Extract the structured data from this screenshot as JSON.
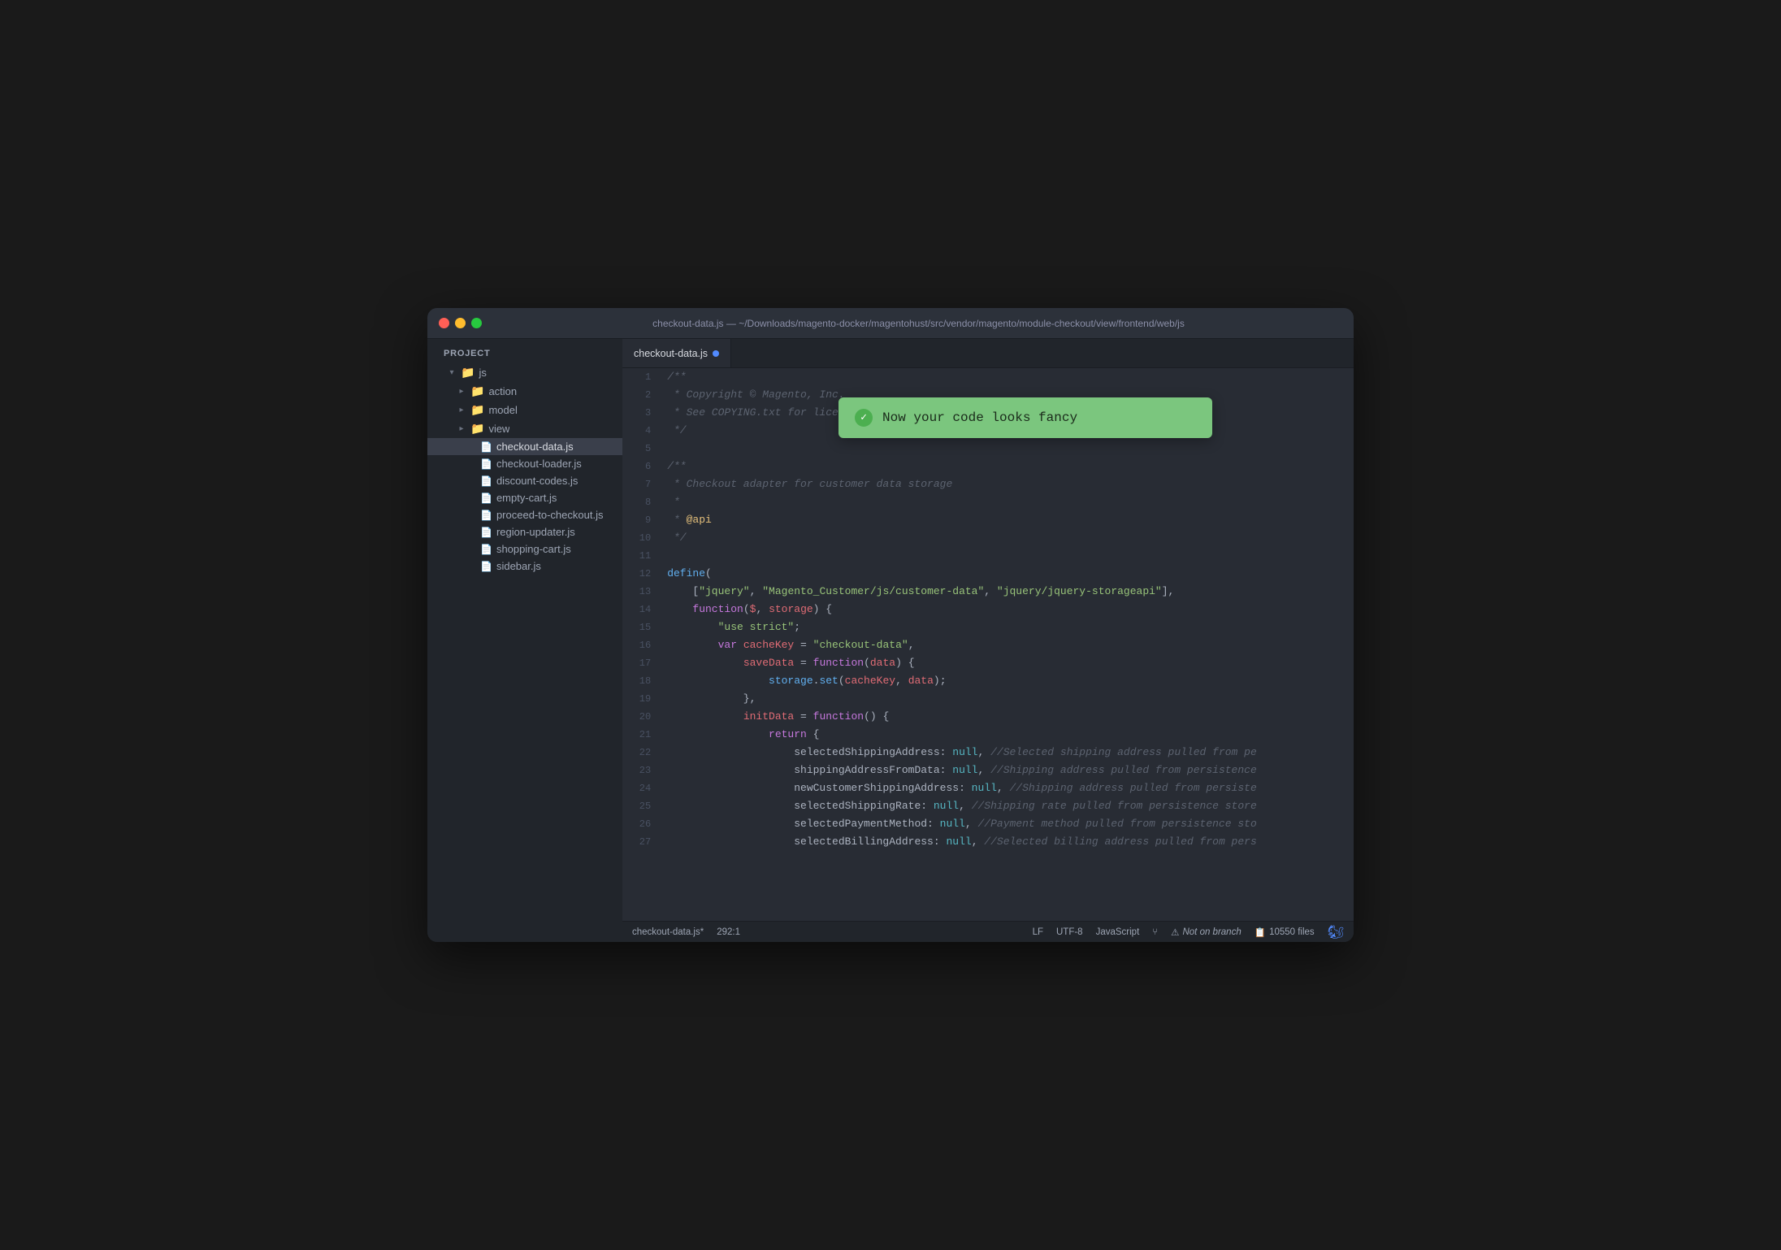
{
  "window": {
    "title": "checkout-data.js — ~/Downloads/magento-docker/magentohust/src/vendor/magento/module-checkout/view/frontend/web/js"
  },
  "titleBar": {
    "trafficLights": [
      "close",
      "minimize",
      "maximize"
    ]
  },
  "sidebar": {
    "title": "Project",
    "tree": [
      {
        "id": "js",
        "label": "js",
        "type": "folder",
        "level": 0,
        "expanded": true
      },
      {
        "id": "action",
        "label": "action",
        "type": "folder",
        "level": 1,
        "expanded": false
      },
      {
        "id": "model",
        "label": "model",
        "type": "folder",
        "level": 1,
        "expanded": false
      },
      {
        "id": "view",
        "label": "view",
        "type": "folder",
        "level": 1,
        "expanded": false
      },
      {
        "id": "checkout-data.js",
        "label": "checkout-data.js",
        "type": "file",
        "level": 2,
        "active": true
      },
      {
        "id": "checkout-loader.js",
        "label": "checkout-loader.js",
        "type": "file",
        "level": 2
      },
      {
        "id": "discount-codes.js",
        "label": "discount-codes.js",
        "type": "file",
        "level": 2
      },
      {
        "id": "empty-cart.js",
        "label": "empty-cart.js",
        "type": "file",
        "level": 2
      },
      {
        "id": "proceed-to-checkout.js",
        "label": "proceed-to-checkout.js",
        "type": "file",
        "level": 2
      },
      {
        "id": "region-updater.js",
        "label": "region-updater.js",
        "type": "file",
        "level": 2
      },
      {
        "id": "shopping-cart.js",
        "label": "shopping-cart.js",
        "type": "file",
        "level": 2
      },
      {
        "id": "sidebar.js",
        "label": "sidebar.js",
        "type": "file",
        "level": 2
      }
    ]
  },
  "editor": {
    "tab": "checkout-data.js",
    "tab_modified": true
  },
  "toast": {
    "message": "Now your code looks fancy",
    "visible": true
  },
  "statusBar": {
    "file": "checkout-data.js*",
    "position": "292:1",
    "lineEnding": "LF",
    "encoding": "UTF-8",
    "language": "JavaScript",
    "branch": "Not on branch",
    "files": "10550 files"
  },
  "code": {
    "lines": [
      {
        "n": 1,
        "text": "/**"
      },
      {
        "n": 2,
        "text": " * Copyright © Magento, Inc."
      },
      {
        "n": 3,
        "text": " * See COPYING.txt for licen..."
      },
      {
        "n": 4,
        "text": " */"
      },
      {
        "n": 5,
        "text": ""
      },
      {
        "n": 6,
        "text": "/**"
      },
      {
        "n": 7,
        "text": " * Checkout adapter for customer data storage"
      },
      {
        "n": 8,
        "text": " *"
      },
      {
        "n": 9,
        "text": " * @api"
      },
      {
        "n": 10,
        "text": " */"
      },
      {
        "n": 11,
        "text": ""
      },
      {
        "n": 12,
        "text": "define("
      },
      {
        "n": 13,
        "text": "    [\"jquery\", \"Magento_Customer/js/customer-data\", \"jquery/jquery-storageapi\"],"
      },
      {
        "n": 14,
        "text": "    function($, storage) {"
      },
      {
        "n": 15,
        "text": "        \"use strict\";"
      },
      {
        "n": 16,
        "text": "        var cacheKey = \"checkout-data\","
      },
      {
        "n": 17,
        "text": "            saveData = function(data) {"
      },
      {
        "n": 18,
        "text": "                storage.set(cacheKey, data);"
      },
      {
        "n": 19,
        "text": "            },"
      },
      {
        "n": 20,
        "text": "            initData = function() {"
      },
      {
        "n": 21,
        "text": "                return {"
      },
      {
        "n": 22,
        "text": "                    selectedShippingAddress: null, //Selected shipping address pulled from pe"
      },
      {
        "n": 23,
        "text": "                    shippingAddressFromData: null, //Shipping address pulled from persistence"
      },
      {
        "n": 24,
        "text": "                    newCustomerShippingAddress: null, //Shipping address pulled from persiste"
      },
      {
        "n": 25,
        "text": "                    selectedShippingRate: null, //Shipping rate pulled from persistence store"
      },
      {
        "n": 26,
        "text": "                    selectedPaymentMethod: null, //Payment method pulled from persistence sto"
      },
      {
        "n": 27,
        "text": "                    selectedBillingAddress: null, //Selected billing address pulled from pers"
      }
    ]
  }
}
